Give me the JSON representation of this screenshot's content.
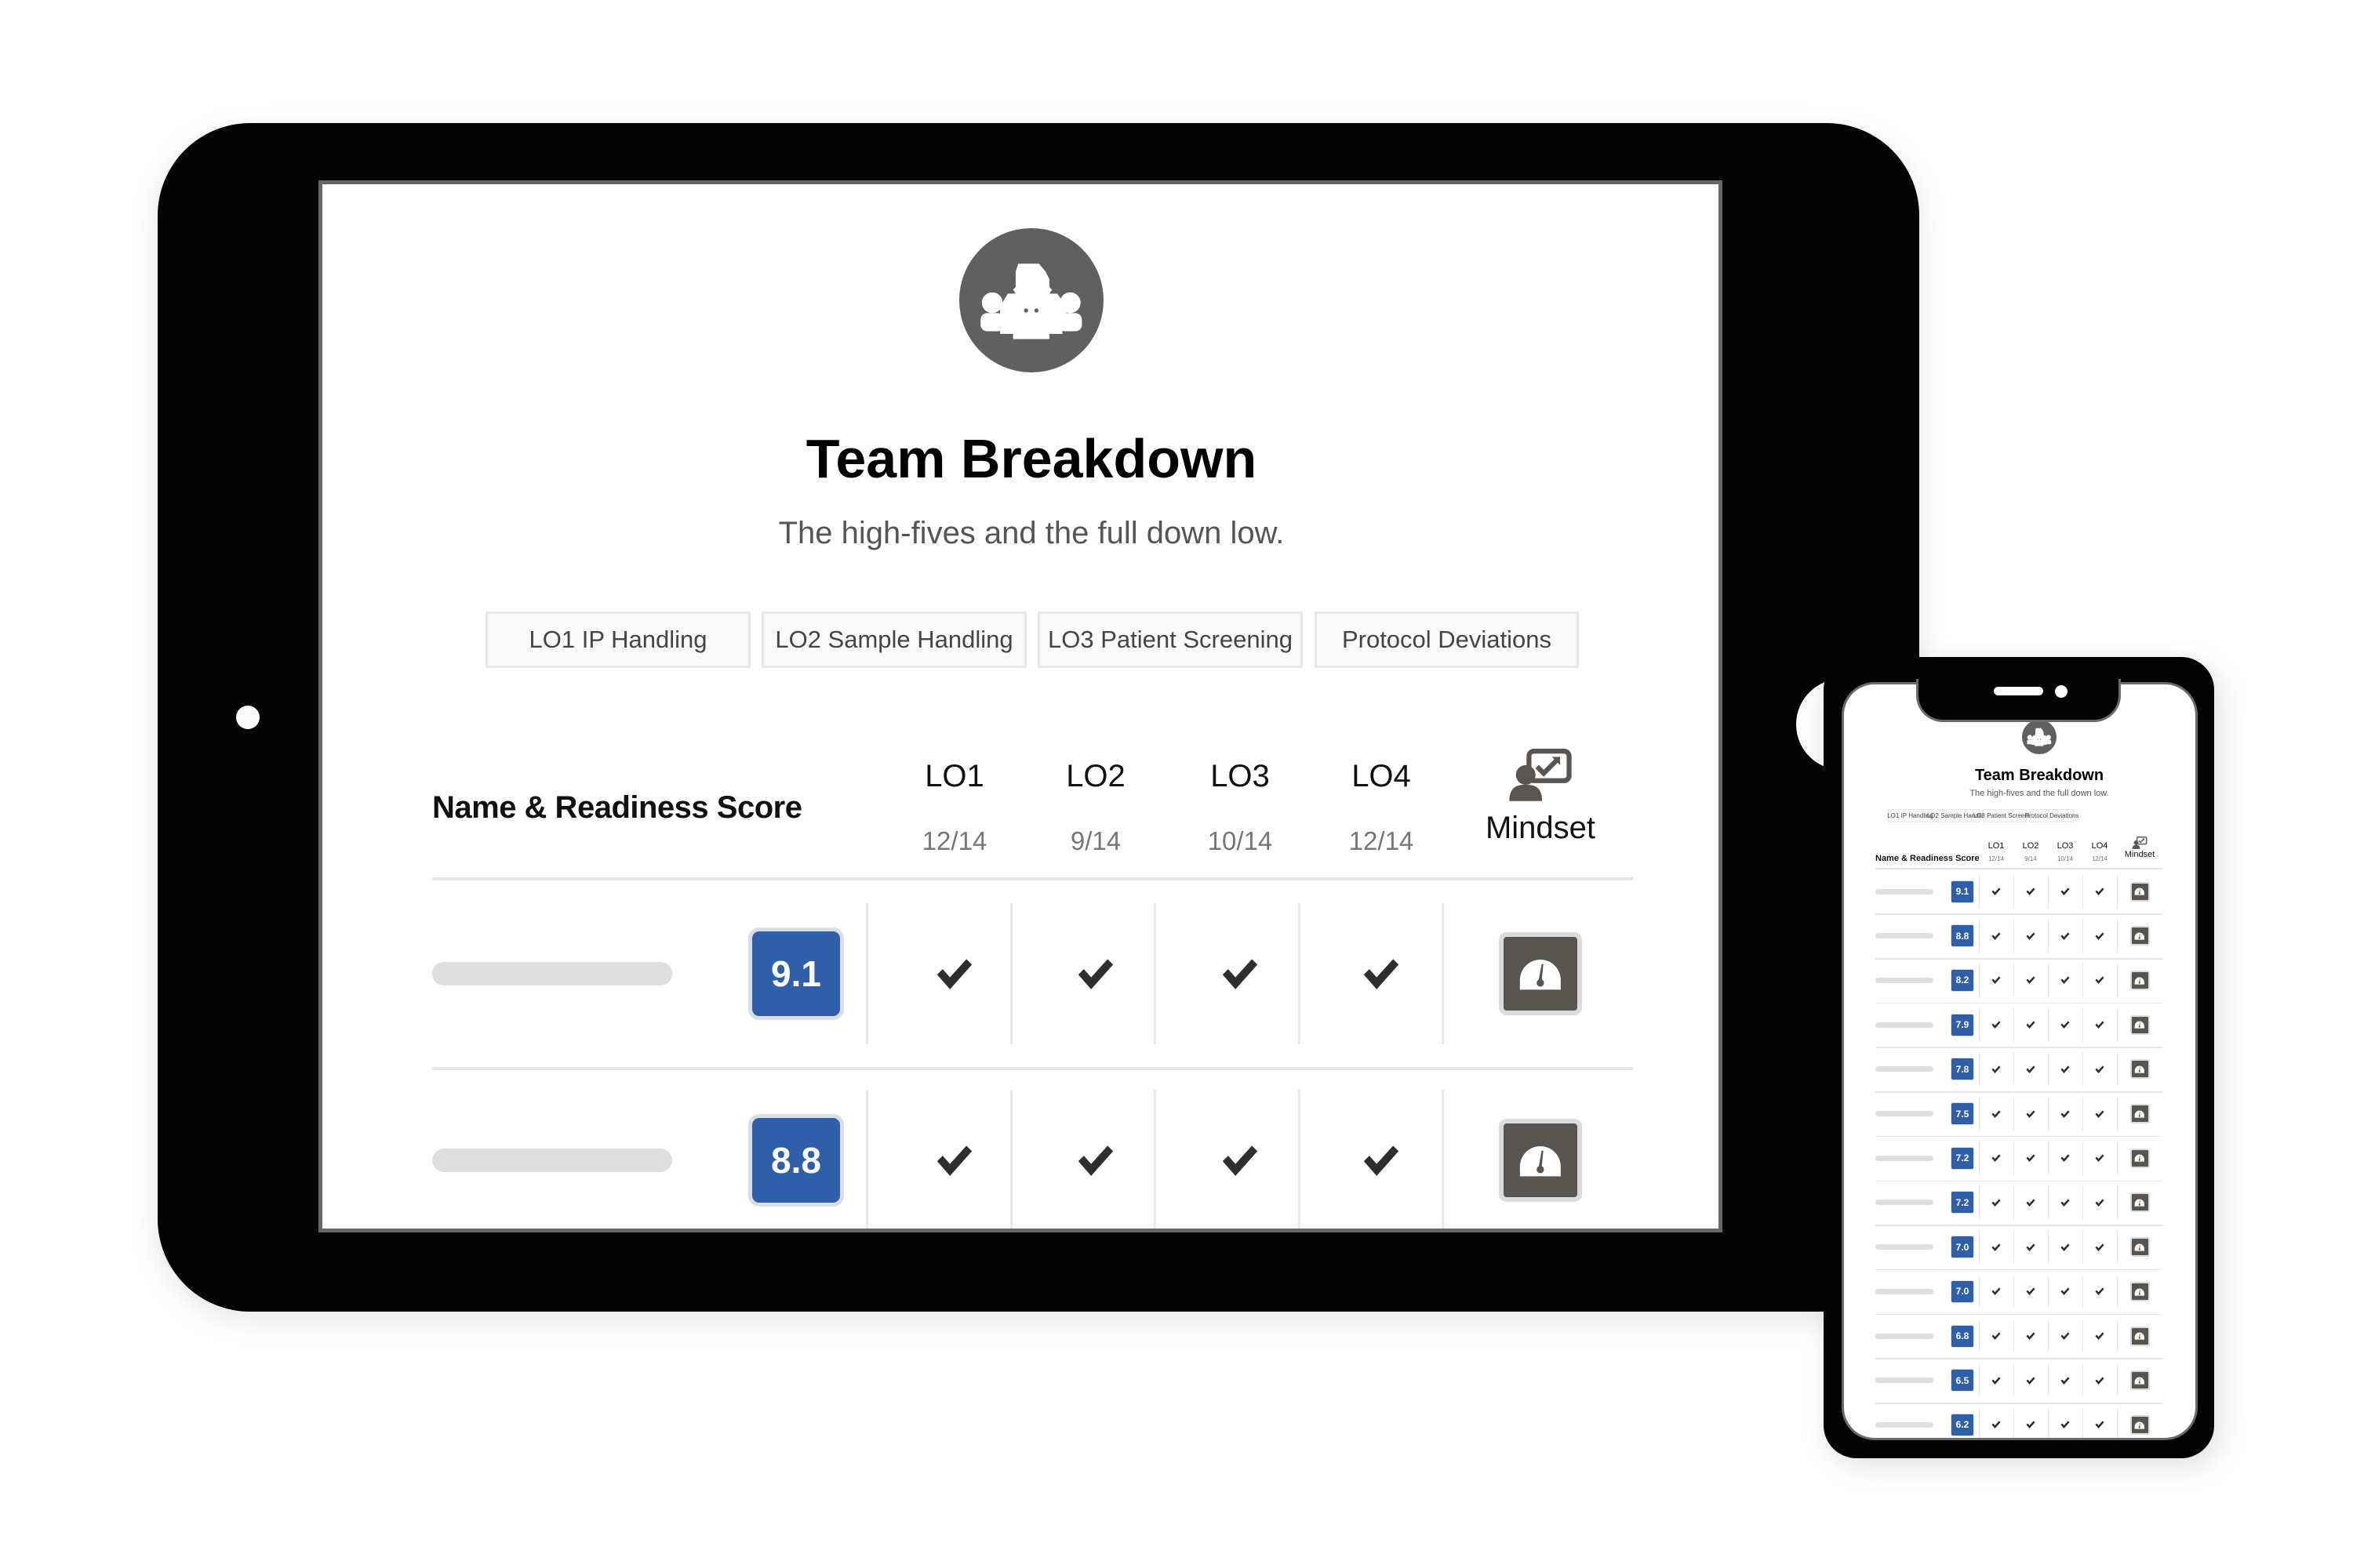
{
  "page": {
    "title": "Team Breakdown",
    "subtitle": "The high-fives and the full down low.",
    "team_icon": "team-group-icon"
  },
  "tabs": [
    {
      "label": "LO1 IP Handling"
    },
    {
      "label": "LO2 Sample Handling"
    },
    {
      "label": "LO3 Patient Screening"
    },
    {
      "label": "Protocol Deviations"
    }
  ],
  "table": {
    "name_header": "Name & Readiness Score",
    "columns": [
      {
        "label": "LO1",
        "fraction": "12/14"
      },
      {
        "label": "LO2",
        "fraction": "9/14"
      },
      {
        "label": "LO3",
        "fraction": "10/14"
      },
      {
        "label": "LO4",
        "fraction": "12/14"
      }
    ],
    "mindset_header": "Mindset",
    "mindset_header_icon": "presentation-person-icon",
    "check_icon": "checkmark-icon",
    "mindset_icon": "gauge-icon",
    "rows": [
      {
        "score": "9.1",
        "checks": [
          true,
          true,
          true,
          true
        ]
      },
      {
        "score": "8.8",
        "checks": [
          true,
          true,
          true,
          true
        ]
      },
      {
        "score": "8.2",
        "checks": [
          true,
          true,
          true,
          true
        ]
      },
      {
        "score": "7.9",
        "checks": [
          true,
          true,
          true,
          true
        ]
      },
      {
        "score": "7.8",
        "checks": [
          true,
          true,
          true,
          true
        ]
      },
      {
        "score": "7.5",
        "checks": [
          true,
          true,
          true,
          true
        ]
      },
      {
        "score": "7.2",
        "checks": [
          true,
          true,
          true,
          true
        ]
      },
      {
        "score": "7.2",
        "checks": [
          true,
          true,
          true,
          true
        ]
      },
      {
        "score": "7.0",
        "checks": [
          true,
          true,
          true,
          true
        ]
      },
      {
        "score": "7.0",
        "checks": [
          true,
          true,
          true,
          true
        ]
      },
      {
        "score": "6.8",
        "checks": [
          true,
          true,
          true,
          true
        ]
      },
      {
        "score": "6.5",
        "checks": [
          true,
          true,
          true,
          true
        ]
      },
      {
        "score": "6.2",
        "checks": [
          true,
          true,
          true,
          true
        ]
      }
    ]
  },
  "colors": {
    "score_badge": "#2e5fa8",
    "mindset_gauge": "#585450",
    "device_frame": "#030303"
  }
}
